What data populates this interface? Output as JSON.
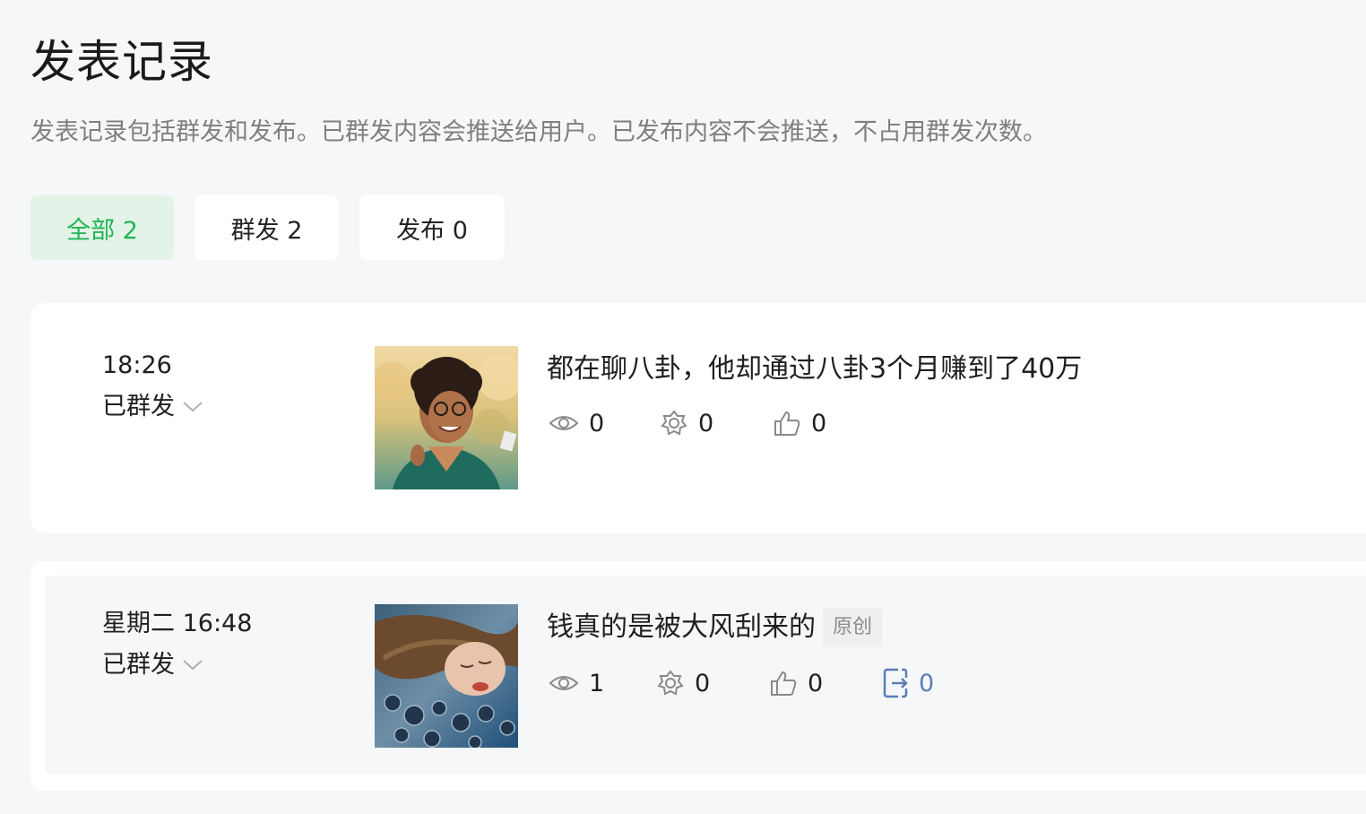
{
  "header": {
    "title": "发表记录",
    "description": "发表记录包括群发和发布。已群发内容会推送给用户。已发布内容不会推送，不占用群发次数。"
  },
  "tabs": [
    {
      "label": "全部 2",
      "active": true
    },
    {
      "label": "群发 2",
      "active": false
    },
    {
      "label": "发布 0",
      "active": false
    }
  ],
  "colors": {
    "accent": "#20b554",
    "accent_bg": "#e3f3e7",
    "link_blue": "#5b7fb5"
  },
  "posts": [
    {
      "time": "18:26",
      "status": "已群发",
      "title": "都在聊八卦，他却通过八卦3个月赚到了40万",
      "badge": "",
      "thumbnail": "woman-with-glasses-illustration",
      "stats": {
        "views": "0",
        "shares": "0",
        "likes": "0"
      }
    },
    {
      "time": "星期二 16:48",
      "status": "已群发",
      "title": "钱真的是被大风刮来的",
      "badge": "原创",
      "thumbnail": "woman-lying-in-water-illustration",
      "stats": {
        "views": "1",
        "shares": "0",
        "likes": "0",
        "forwards": "0"
      }
    }
  ],
  "icons": {
    "views": "eye-icon",
    "shares": "share-gear-icon",
    "likes": "thumbs-up-icon",
    "forwards": "forward-icon",
    "status_dropdown": "chevron-down-icon"
  }
}
